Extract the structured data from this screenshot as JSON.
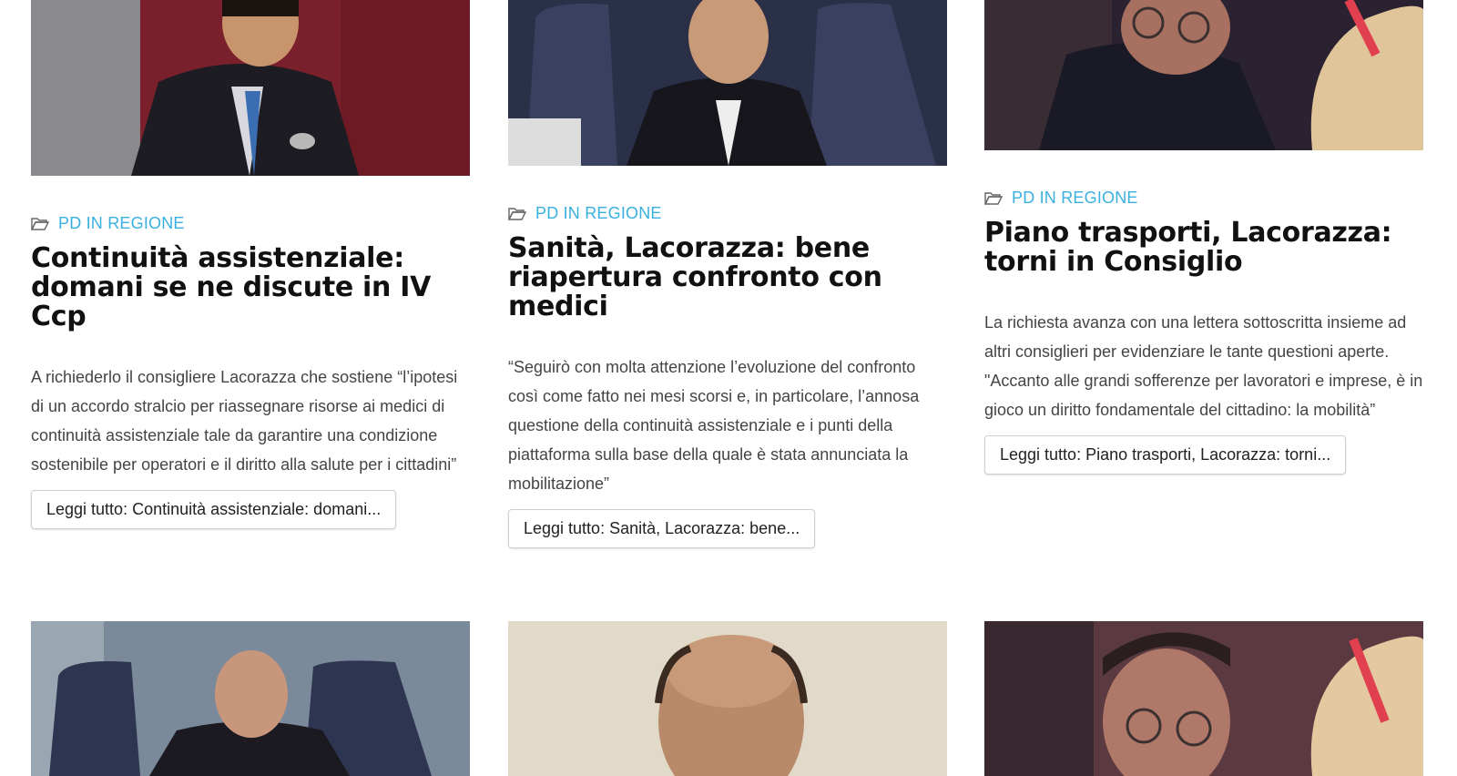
{
  "articles": [
    {
      "category": "PD IN REGIONE",
      "title": "Continuità assistenziale: domani se ne discute in IV Ccp",
      "excerpt": "A richiederlo il consigliere Lacorazza che sostiene “l’ipotesi di un accordo stralcio per riassegnare risorse ai medici di continuità assistenziale tale da garantire una condizione sostenibile per operatori e il diritto alla salute per i cittadini”",
      "read_more": "Leggi tutto: Continuità assistenziale: domani..."
    },
    {
      "category": "PD IN REGIONE",
      "title": "Sanità, Lacorazza: bene riapertura confronto con medici",
      "excerpt": "“Seguirò con molta attenzione l’evoluzione del confronto così come fatto nei mesi scorsi e, in particolare, l’annosa questione della continuità assistenziale e i punti della piattaforma sulla base della quale è stata annunciata la mobilitazione”",
      "read_more": "Leggi tutto: Sanità, Lacorazza: bene..."
    },
    {
      "category": "PD IN REGIONE",
      "title": "Piano trasporti, Lacorazza: torni in Consiglio",
      "excerpt": "La richiesta avanza con una lettera sottoscritta insieme ad altri consiglieri per evidenziare le tante questioni aperte. \"Accanto alle grandi sofferenze per lavoratori e imprese, è in gioco un diritto fondamentale del cittadino: la mobilità”",
      "read_more": "Leggi tutto: Piano trasporti, Lacorazza: torni..."
    }
  ],
  "icons": {
    "category": "folder-open-icon"
  },
  "colors": {
    "category": "#3ab0e0",
    "text": "#111111",
    "excerpt": "#444444"
  }
}
